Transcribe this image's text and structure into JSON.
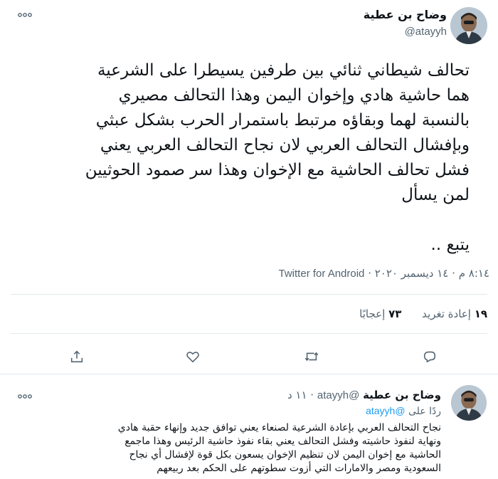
{
  "main_tweet": {
    "author_name": "وضاح بن عطية",
    "author_handle": "@atayyh",
    "more_icon": "more-horizontal-icon",
    "text": "تحالف شيطاني ثنائي بين طرفين يسيطرا على الشرعية\nهما حاشية هادي وإخوان اليمن وهذا التحالف مصيري\nبالنسبة لهما وبقاؤه مرتبط باستمرار الحرب بشكل عبثي\nوبإفشال التحالف العربي لان نجاح التحالف العربي يعني\nفشل تحالف الحاشية مع الإخوان وهذا سر صمود الحوثيين\nلمن يسأل\n\nيتبع ..",
    "time": "٨:١٤ م",
    "separator": "·",
    "date": "١٤ ديسمبر ٢٠٢٠",
    "client": "Twitter for Android",
    "retweets_count": "١٩",
    "retweets_label": "إعادة تغريد",
    "likes_count": "٧٣",
    "likes_label": "إعجابًا",
    "actions": [
      "reply-icon",
      "retweet-icon",
      "like-icon",
      "share-icon"
    ]
  },
  "reply_tweet": {
    "author_name": "وضاح بن عطية",
    "author_handle": "@atayyh",
    "time": "١١ د",
    "replying_label": "ردًا على",
    "replying_handle": "@atayyh",
    "text": "نجاح التحالف العربي بإعادة الشرعية لصنعاء يعني توافق جديد وإنهاء حقبة هادي\nونهاية لنفوذ حاشيته وفشل التحالف يعني بقاء نفوذ حاشية الرئيس وهذا ماجمع\nالحاشية مع إخوان اليمن لان تنظيم الإخوان يسعون بكل قوة لإفشال أي نجاح\nالسعودية ومصر والامارات التي أزوت سطوتهم على الحكم بعد ربيعهم"
  }
}
